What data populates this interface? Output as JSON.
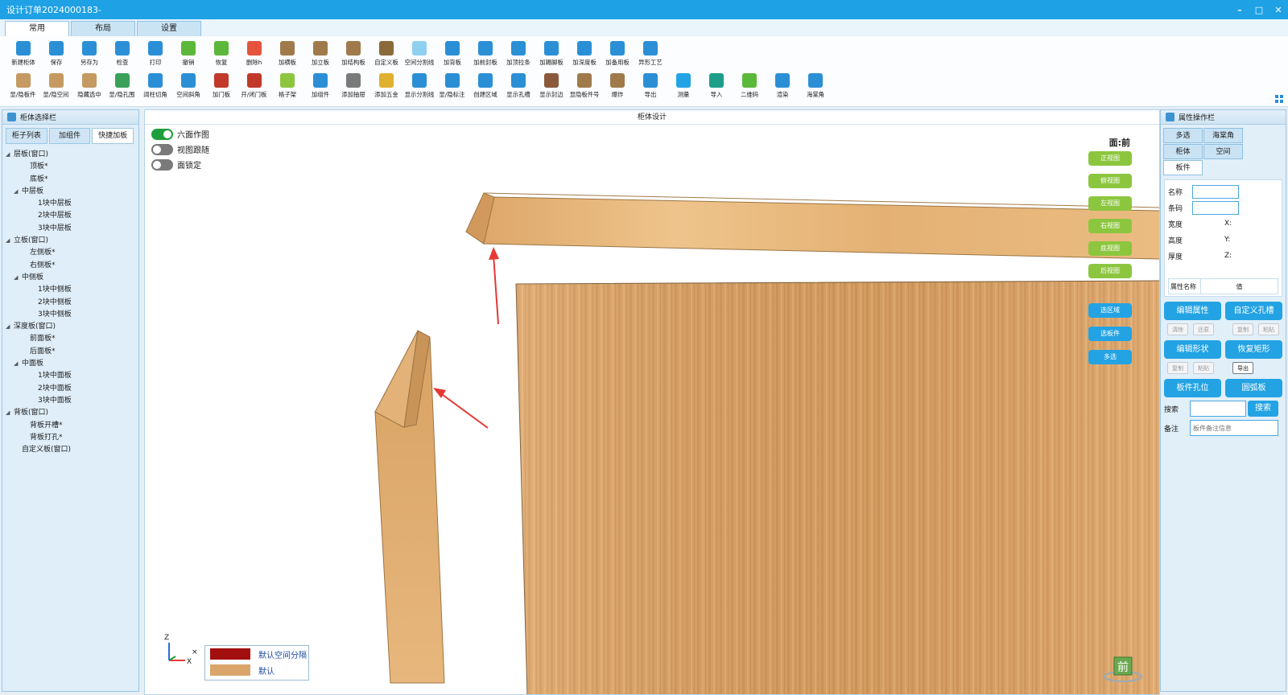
{
  "window": {
    "title": "设计订单2024000183-",
    "controls": [
      "–",
      "□",
      "✕"
    ]
  },
  "ribbon_tabs": [
    {
      "label": "常用",
      "active": true
    },
    {
      "label": "布局",
      "active": false
    },
    {
      "label": "设置",
      "active": false
    }
  ],
  "toolbar": {
    "row1": [
      {
        "label": "新建柜体",
        "icon": "new-cabinet-icon",
        "color": "#2b8fd6"
      },
      {
        "label": "保存",
        "icon": "save-icon",
        "color": "#2b8fd6"
      },
      {
        "label": "另存为",
        "icon": "save-as-icon",
        "color": "#2b8fd6"
      },
      {
        "label": "检查",
        "icon": "check-icon",
        "color": "#2b8fd6"
      },
      {
        "label": "打印",
        "icon": "print-icon",
        "color": "#2b8fd6"
      },
      {
        "label": "撤销",
        "icon": "undo-icon",
        "color": "#5cb83a"
      },
      {
        "label": "恢复",
        "icon": "redo-icon",
        "color": "#5cb83a"
      },
      {
        "label": "删除h",
        "icon": "delete-icon",
        "color": "#e5533d"
      },
      {
        "label": "加横板",
        "icon": "add-horizontal-board-icon",
        "color": "#a07a4b"
      },
      {
        "label": "加立板",
        "icon": "add-vertical-board-icon",
        "color": "#a07a4b"
      },
      {
        "label": "加结构板",
        "icon": "add-structure-board-icon",
        "color": "#a07a4b"
      },
      {
        "label": "自定义板",
        "icon": "custom-board-icon",
        "color": "#8a6a3b"
      },
      {
        "label": "空间分割线",
        "icon": "space-divider-icon",
        "color": "#8fd0f0"
      },
      {
        "label": "加背板",
        "icon": "add-back-board-icon",
        "color": "#2b8fd6"
      },
      {
        "label": "加前封板",
        "icon": "add-front-seal-icon",
        "color": "#2b8fd6"
      },
      {
        "label": "加顶拉条",
        "icon": "add-top-strip-icon",
        "color": "#2b8fd6"
      },
      {
        "label": "加踢脚板",
        "icon": "add-skirting-icon",
        "color": "#2b8fd6"
      },
      {
        "label": "加深度板",
        "icon": "add-depth-board-icon",
        "color": "#2b8fd6"
      },
      {
        "label": "加备用板",
        "icon": "add-spare-board-icon",
        "color": "#2b8fd6"
      },
      {
        "label": "异形工艺",
        "icon": "special-shape-icon",
        "color": "#2b8fd6"
      }
    ],
    "row2": [
      {
        "label": "显/隐板件",
        "icon": "toggle-board-icon",
        "color": "#c49a62"
      },
      {
        "label": "显/隐空间",
        "icon": "toggle-space-icon",
        "color": "#c49a62"
      },
      {
        "label": "隐藏选中",
        "icon": "hide-selected-icon",
        "color": "#c49a62"
      },
      {
        "label": "显/隐孔围",
        "icon": "toggle-hole-icon",
        "color": "#3aa15a"
      },
      {
        "label": "阔柱切角",
        "icon": "column-cut-icon",
        "color": "#2b8fd6"
      },
      {
        "label": "空间斜角",
        "icon": "space-bevel-icon",
        "color": "#2b8fd6"
      },
      {
        "label": "加门板",
        "icon": "add-door-icon",
        "color": "#c0392b"
      },
      {
        "label": "开/闭门板",
        "icon": "open-door-icon",
        "color": "#c0392b"
      },
      {
        "label": "格子架",
        "icon": "grid-shelf-icon",
        "color": "#8cc63f"
      },
      {
        "label": "加组件",
        "icon": "add-component-icon",
        "color": "#2b8fd6"
      },
      {
        "label": "添加抽屉",
        "icon": "add-drawer-icon",
        "color": "#7a7a7a"
      },
      {
        "label": "添加五金",
        "icon": "add-hardware-icon",
        "color": "#e0b030"
      },
      {
        "label": "显示分割线",
        "icon": "show-divider-icon",
        "color": "#2b8fd6"
      },
      {
        "label": "显/隐标注",
        "icon": "toggle-dimension-icon",
        "color": "#2b8fd6"
      },
      {
        "label": "创建区域",
        "icon": "create-area-icon",
        "color": "#2b8fd6"
      },
      {
        "label": "显示孔槽",
        "icon": "show-slot-icon",
        "color": "#2b8fd6"
      },
      {
        "label": "显示封边",
        "icon": "show-edge-icon",
        "color": "#8a5a3b"
      },
      {
        "label": "显隐板件号",
        "icon": "board-number-icon",
        "color": "#a07a4b"
      },
      {
        "label": "爆炸",
        "icon": "explode-icon",
        "color": "#a07a4b"
      },
      {
        "label": "导出",
        "icon": "export-icon",
        "color": "#2b8fd6"
      },
      {
        "label": "测量",
        "icon": "measure-icon",
        "color": "#23a3e3"
      },
      {
        "label": "导入",
        "icon": "import-icon",
        "color": "#1e9e8a"
      },
      {
        "label": "二维码",
        "icon": "qrcode-icon",
        "color": "#5cb83a"
      },
      {
        "label": "渲染",
        "icon": "render-icon",
        "color": "#2b8fd6"
      },
      {
        "label": "海棠角",
        "icon": "begonia-corner-icon",
        "color": "#2b8fd6"
      }
    ]
  },
  "left_panel": {
    "title": "柜体选择栏",
    "tabs": [
      {
        "label": "柜子列表",
        "active": false
      },
      {
        "label": "加组件",
        "active": false
      },
      {
        "label": "快捷加板",
        "active": true
      }
    ],
    "tree": [
      {
        "label": "层板(窗口)",
        "level": 0,
        "toggle": "◢"
      },
      {
        "label": "顶板*",
        "level": 2,
        "toggle": ""
      },
      {
        "label": "底板*",
        "level": 2,
        "toggle": ""
      },
      {
        "label": "中层板",
        "level": 1,
        "toggle": "◢"
      },
      {
        "label": "1块中层板",
        "level": 3,
        "toggle": ""
      },
      {
        "label": "2块中层板",
        "level": 3,
        "toggle": ""
      },
      {
        "label": "3块中层板",
        "level": 3,
        "toggle": ""
      },
      {
        "label": "立板(窗口)",
        "level": 0,
        "toggle": "◢"
      },
      {
        "label": "左侧板*",
        "level": 2,
        "toggle": ""
      },
      {
        "label": "右侧板*",
        "level": 2,
        "toggle": ""
      },
      {
        "label": "中侧板",
        "level": 1,
        "toggle": "◢"
      },
      {
        "label": "1块中侧板",
        "level": 3,
        "toggle": ""
      },
      {
        "label": "2块中侧板",
        "level": 3,
        "toggle": ""
      },
      {
        "label": "3块中侧板",
        "level": 3,
        "toggle": ""
      },
      {
        "label": "深度板(窗口)",
        "level": 0,
        "toggle": "◢"
      },
      {
        "label": "前面板*",
        "level": 2,
        "toggle": ""
      },
      {
        "label": "后面板*",
        "level": 2,
        "toggle": ""
      },
      {
        "label": "中面板",
        "level": 1,
        "toggle": "◢"
      },
      {
        "label": "1块中面板",
        "level": 3,
        "toggle": ""
      },
      {
        "label": "2块中面板",
        "level": 3,
        "toggle": ""
      },
      {
        "label": "3块中面板",
        "level": 3,
        "toggle": ""
      },
      {
        "label": "背板(窗口)",
        "level": 0,
        "toggle": "◢"
      },
      {
        "label": "背板开槽*",
        "level": 2,
        "toggle": ""
      },
      {
        "label": "背板打孔*",
        "level": 2,
        "toggle": ""
      },
      {
        "label": "自定义板(窗口)",
        "level": 1,
        "toggle": ""
      }
    ]
  },
  "canvas": {
    "title": "柜体设计",
    "toggles": [
      {
        "label": "六面作图",
        "on": true
      },
      {
        "label": "视图跟随",
        "on": false
      },
      {
        "label": "面锁定",
        "on": false
      }
    ],
    "face_label": "面:前",
    "view_buttons": [
      "正视图",
      "俯视图",
      "左视图",
      "右视图",
      "底视图",
      "后视图"
    ],
    "select_buttons": [
      "选区域",
      "选板件",
      "多选"
    ],
    "legend": [
      {
        "label": "默认空间分隔",
        "color": "#a30f0f"
      },
      {
        "label": "默认",
        "color": "#d9a56a"
      }
    ],
    "axes": {
      "z": "Z",
      "x": "X"
    },
    "front_cube_label": "前"
  },
  "right_panel": {
    "title": "属性操作栏",
    "tabs_row1": [
      {
        "label": "多选",
        "active": false
      },
      {
        "label": "海棠角",
        "active": false
      }
    ],
    "tabs_row2": [
      {
        "label": "柜体",
        "active": false
      },
      {
        "label": "空间",
        "active": false
      },
      {
        "label": "板件",
        "active": true
      }
    ],
    "fields": {
      "name_label": "名称",
      "name_value": "",
      "code_label": "条码",
      "code_value": "",
      "width_label": "宽度",
      "height_label": "高度",
      "thickness_label": "厚度",
      "x_label": "X:",
      "y_label": "Y:",
      "z_label": "Z:"
    },
    "table_headers": [
      "属性名称",
      "值"
    ],
    "buttons": {
      "edit_props": "编辑属性",
      "custom_slot": "自定义孔槽",
      "edit_shape": "编辑形状",
      "restore_rect": "恢复矩形",
      "board_hole": "板件孔位",
      "arc_board": "圆弧板",
      "clear": "清除",
      "restore": "还原",
      "copy": "复制",
      "paste": "粘贴",
      "export": "导出"
    },
    "search_label": "搜索",
    "search_button": "搜索",
    "note_label": "备注",
    "note_placeholder": "板件备注信息"
  }
}
